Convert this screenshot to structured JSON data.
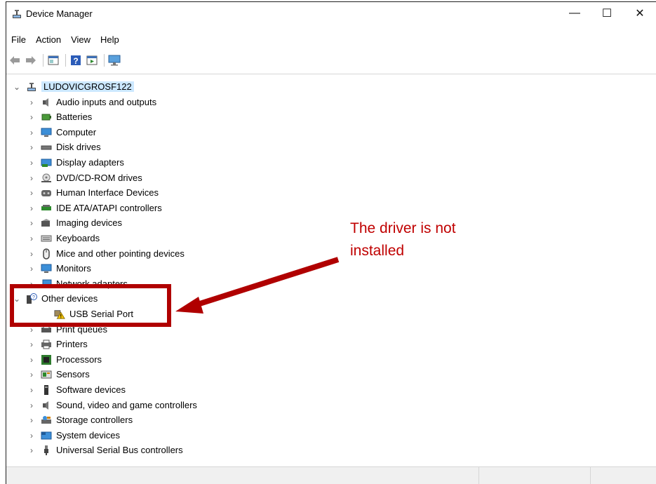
{
  "window": {
    "title": "Device Manager",
    "controls": {
      "minimize": "—",
      "maximize": "☐",
      "close": "✕"
    }
  },
  "menu": [
    "File",
    "Action",
    "View",
    "Help"
  ],
  "toolbar": [
    "back-icon",
    "forward-icon",
    "properties-icon",
    "help-icon",
    "update-driver-icon",
    "monitor-icon"
  ],
  "tree": {
    "root": "LUDOVICGROSF122",
    "categories": [
      {
        "label": "Audio inputs and outputs",
        "icon": "speaker-icon"
      },
      {
        "label": "Batteries",
        "icon": "battery-icon"
      },
      {
        "label": "Computer",
        "icon": "computer-icon"
      },
      {
        "label": "Disk drives",
        "icon": "disk-icon"
      },
      {
        "label": "Display adapters",
        "icon": "display-adapter-icon"
      },
      {
        "label": "DVD/CD-ROM drives",
        "icon": "dvd-icon"
      },
      {
        "label": "Human Interface Devices",
        "icon": "hid-icon"
      },
      {
        "label": "IDE ATA/ATAPI controllers",
        "icon": "ide-icon"
      },
      {
        "label": "Imaging devices",
        "icon": "camera-icon"
      },
      {
        "label": "Keyboards",
        "icon": "keyboard-icon"
      },
      {
        "label": "Mice and other pointing devices",
        "icon": "mouse-icon"
      },
      {
        "label": "Monitors",
        "icon": "monitor-icon"
      },
      {
        "label": "Network adapters",
        "icon": "network-icon"
      },
      {
        "label": "Other devices",
        "icon": "unknown-device-icon",
        "expanded": true
      },
      {
        "label": "USB Serial Port",
        "icon": "warning-device-icon",
        "child": true
      },
      {
        "label": "Print queues",
        "icon": "print-queue-icon"
      },
      {
        "label": "Printers",
        "icon": "printer-icon"
      },
      {
        "label": "Processors",
        "icon": "processor-icon"
      },
      {
        "label": "Sensors",
        "icon": "sensor-icon"
      },
      {
        "label": "Software devices",
        "icon": "software-device-icon"
      },
      {
        "label": "Sound, video and game controllers",
        "icon": "sound-icon"
      },
      {
        "label": "Storage controllers",
        "icon": "storage-icon"
      },
      {
        "label": "System devices",
        "icon": "system-icon"
      },
      {
        "label": "Universal Serial Bus controllers",
        "icon": "usb-icon"
      }
    ]
  },
  "annotation": {
    "line1": "The driver is not",
    "line2": "installed",
    "color": "#c00000"
  }
}
